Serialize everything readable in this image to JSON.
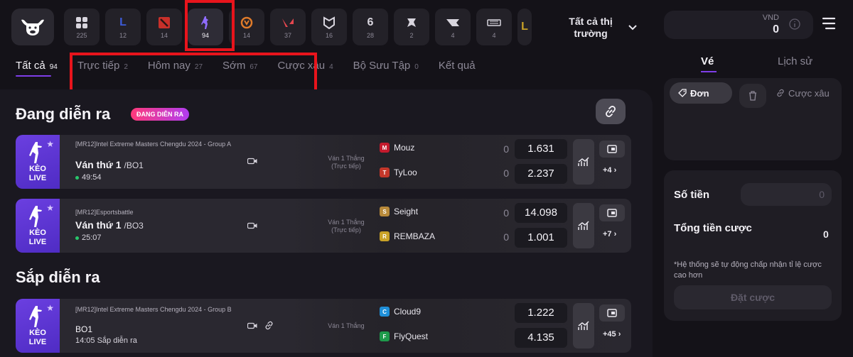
{
  "header": {
    "games": [
      {
        "name": "all-games",
        "count": "225",
        "color": "#8c8896"
      },
      {
        "name": "league-of-legends",
        "count": "12",
        "color": "#3c5bd8"
      },
      {
        "name": "dota-2",
        "count": "14",
        "color": "#c8302a"
      },
      {
        "name": "counter-strike",
        "count": "94",
        "color": "#8f6cff"
      },
      {
        "name": "overwatch",
        "count": "14",
        "color": "#e07b2a"
      },
      {
        "name": "valorant",
        "count": "37",
        "color": "#e5474f"
      },
      {
        "name": "mobile-legends",
        "count": "16",
        "color": "#d8d5de"
      },
      {
        "name": "rainbow-six",
        "count": "28",
        "color": "#d8d5de"
      },
      {
        "name": "king-of-glory",
        "count": "2",
        "color": "#d8d5de"
      },
      {
        "name": "crossfire",
        "count": "4",
        "color": "#d8d5de"
      },
      {
        "name": "wild-rift",
        "count": "4",
        "color": "#d8d5de"
      },
      {
        "name": "lol-variant",
        "count": "",
        "color": "#c9a227"
      }
    ],
    "market_label": "Tất cả thị trường",
    "currency": "VND",
    "balance": "0"
  },
  "tabs": [
    {
      "label": "Tất cả",
      "count": "94",
      "active": true
    },
    {
      "label": "Trực tiếp",
      "count": "2",
      "active": false
    },
    {
      "label": "Hôm nay",
      "count": "27",
      "active": false
    },
    {
      "label": "Sớm",
      "count": "67",
      "active": false
    },
    {
      "label": "Cược xâu",
      "count": "4",
      "active": false
    },
    {
      "label": "Bộ Sưu Tập",
      "count": "0",
      "active": false
    },
    {
      "label": "Kết quả",
      "count": "",
      "active": false
    }
  ],
  "main": {
    "live_title": "Đang diễn ra",
    "live_badge": "ĐANG DIỄN RA",
    "upcoming_title": "Sắp diễn ra",
    "keo_line1": "KÈO",
    "keo_line2": "LIVE",
    "matches": [
      {
        "tournament": "[MR12]Intel Extreme Masters Chengdu 2024 - Group A",
        "match_label": "Ván thứ 1",
        "bo": "/BO1",
        "time": "49:54",
        "bet_type": "Ván 1 Thắng (Trực tiếp)",
        "team1": {
          "name": "Mouz",
          "score": "0",
          "odd": "1.631",
          "color": "#c41a2d"
        },
        "team2": {
          "name": "TyLoo",
          "score": "0",
          "odd": "2.237",
          "color": "#c4372a"
        },
        "more": "+4 ›"
      },
      {
        "tournament": "[MR12]Esportsbattle",
        "match_label": "Ván thứ 1",
        "bo": "/BO3",
        "time": "25:07",
        "bet_type": "Ván 1 Thắng (Trực tiếp)",
        "team1": {
          "name": "Seight",
          "score": "0",
          "odd": "14.098",
          "color": "#b88a3a"
        },
        "team2": {
          "name": "REMBAZA",
          "score": "0",
          "odd": "1.001",
          "color": "#c9a227"
        },
        "more": "+7 ›"
      },
      {
        "tournament": "[MR12]Intel Extreme Masters Chengdu 2024 - Group B",
        "match_label": "BO1",
        "time": "14:05 Sắp diễn ra",
        "bet_type": "Ván 1 Thắng",
        "team1": {
          "name": "Cloud9",
          "odd": "1.222",
          "color": "#1f8fd8"
        },
        "team2": {
          "name": "FlyQuest",
          "odd": "4.135",
          "color": "#1e9a4b"
        },
        "more": "+45 ›"
      }
    ]
  },
  "betslip": {
    "tab_ticket": "Vé",
    "tab_history": "Lịch sử",
    "single": "Đơn",
    "parlay": "Cược xâu",
    "amount_label": "Số tiền",
    "amount_value": "0",
    "total_label": "Tổng tiền cược",
    "total_value": "0",
    "note": "*Hệ thống sẽ tự động chấp nhận tỉ lệ cược cao hơn",
    "place_button": "Đặt cược"
  }
}
